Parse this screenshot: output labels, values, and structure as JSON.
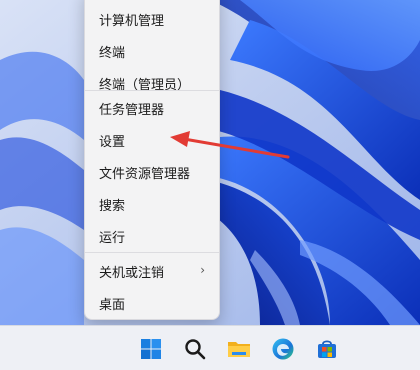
{
  "context_menu": {
    "items": [
      {
        "label": "计算机管理"
      },
      {
        "label": "终端"
      },
      {
        "label": "终端（管理员）"
      },
      {
        "label": "任务管理器"
      },
      {
        "label": "设置"
      },
      {
        "label": "文件资源管理器"
      },
      {
        "label": "搜索"
      },
      {
        "label": "运行"
      },
      {
        "label": "关机或注销",
        "submenu_icon": "chevron-right-icon",
        "chevron": "›"
      },
      {
        "label": "桌面"
      }
    ]
  },
  "annotation": {
    "target": "设置",
    "arrow_color": "#e23b34"
  },
  "taskbar": {
    "items": [
      {
        "icon": "windows-start-icon"
      },
      {
        "icon": "search-icon"
      },
      {
        "icon": "file-explorer-icon"
      },
      {
        "icon": "edge-browser-icon"
      },
      {
        "icon": "microsoft-store-icon"
      }
    ]
  },
  "colors": {
    "menu_bg": "#f3f3f4",
    "taskbar_bg": "#eef0f5",
    "wallpaper_light": "#c6d3f0",
    "wallpaper_blue": "#1546d8",
    "accent_blue": "#1a6fd6"
  }
}
